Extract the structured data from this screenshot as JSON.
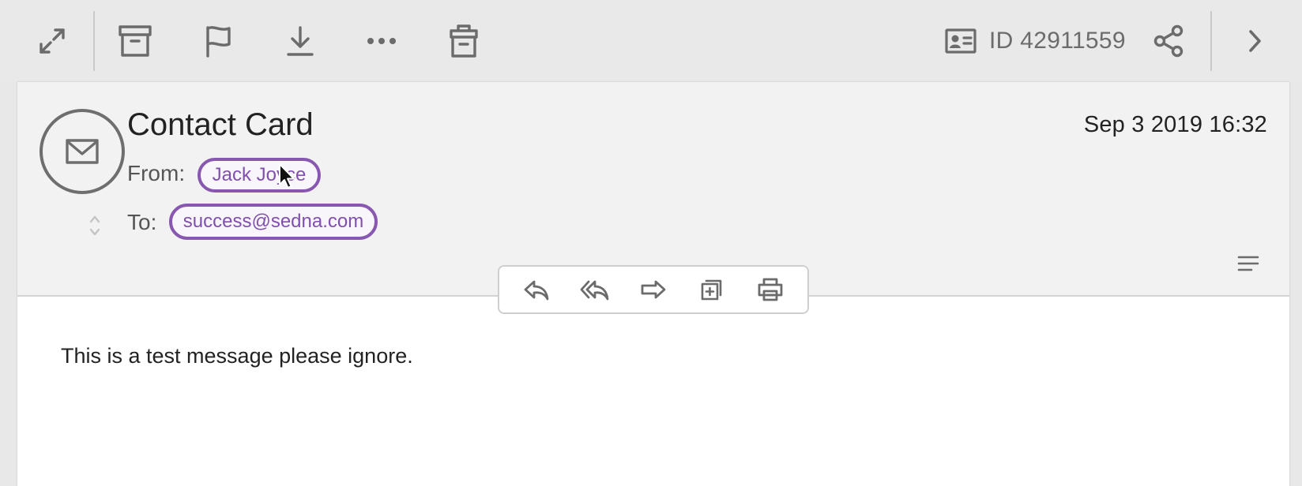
{
  "toolbar": {
    "buttons": [
      {
        "icon": "expand-icon"
      },
      {
        "icon": "archive-icon"
      },
      {
        "icon": "flag-icon"
      },
      {
        "icon": "download-icon"
      },
      {
        "icon": "more-icon"
      },
      {
        "icon": "trash-icon"
      }
    ],
    "id_label": "ID 42911559",
    "share_icon": "share-icon",
    "next_icon": "chevron-right-icon"
  },
  "message": {
    "subject": "Contact Card",
    "date": "Sep 3 2019 16:32",
    "from_label": "From:",
    "from_name": "Jack Joyce",
    "to_label": "To:",
    "to_address": "success@sedna.com",
    "body": "This is a test message please ignore."
  },
  "actions": [
    {
      "icon": "reply-icon"
    },
    {
      "icon": "reply-all-icon"
    },
    {
      "icon": "forward-icon"
    },
    {
      "icon": "copy-icon"
    },
    {
      "icon": "print-icon"
    }
  ],
  "colors": {
    "accent": "#8857b0",
    "icon": "#6b6b6b",
    "toolbar_bg": "#e9e9e9",
    "header_bg": "#f2f2f2"
  }
}
